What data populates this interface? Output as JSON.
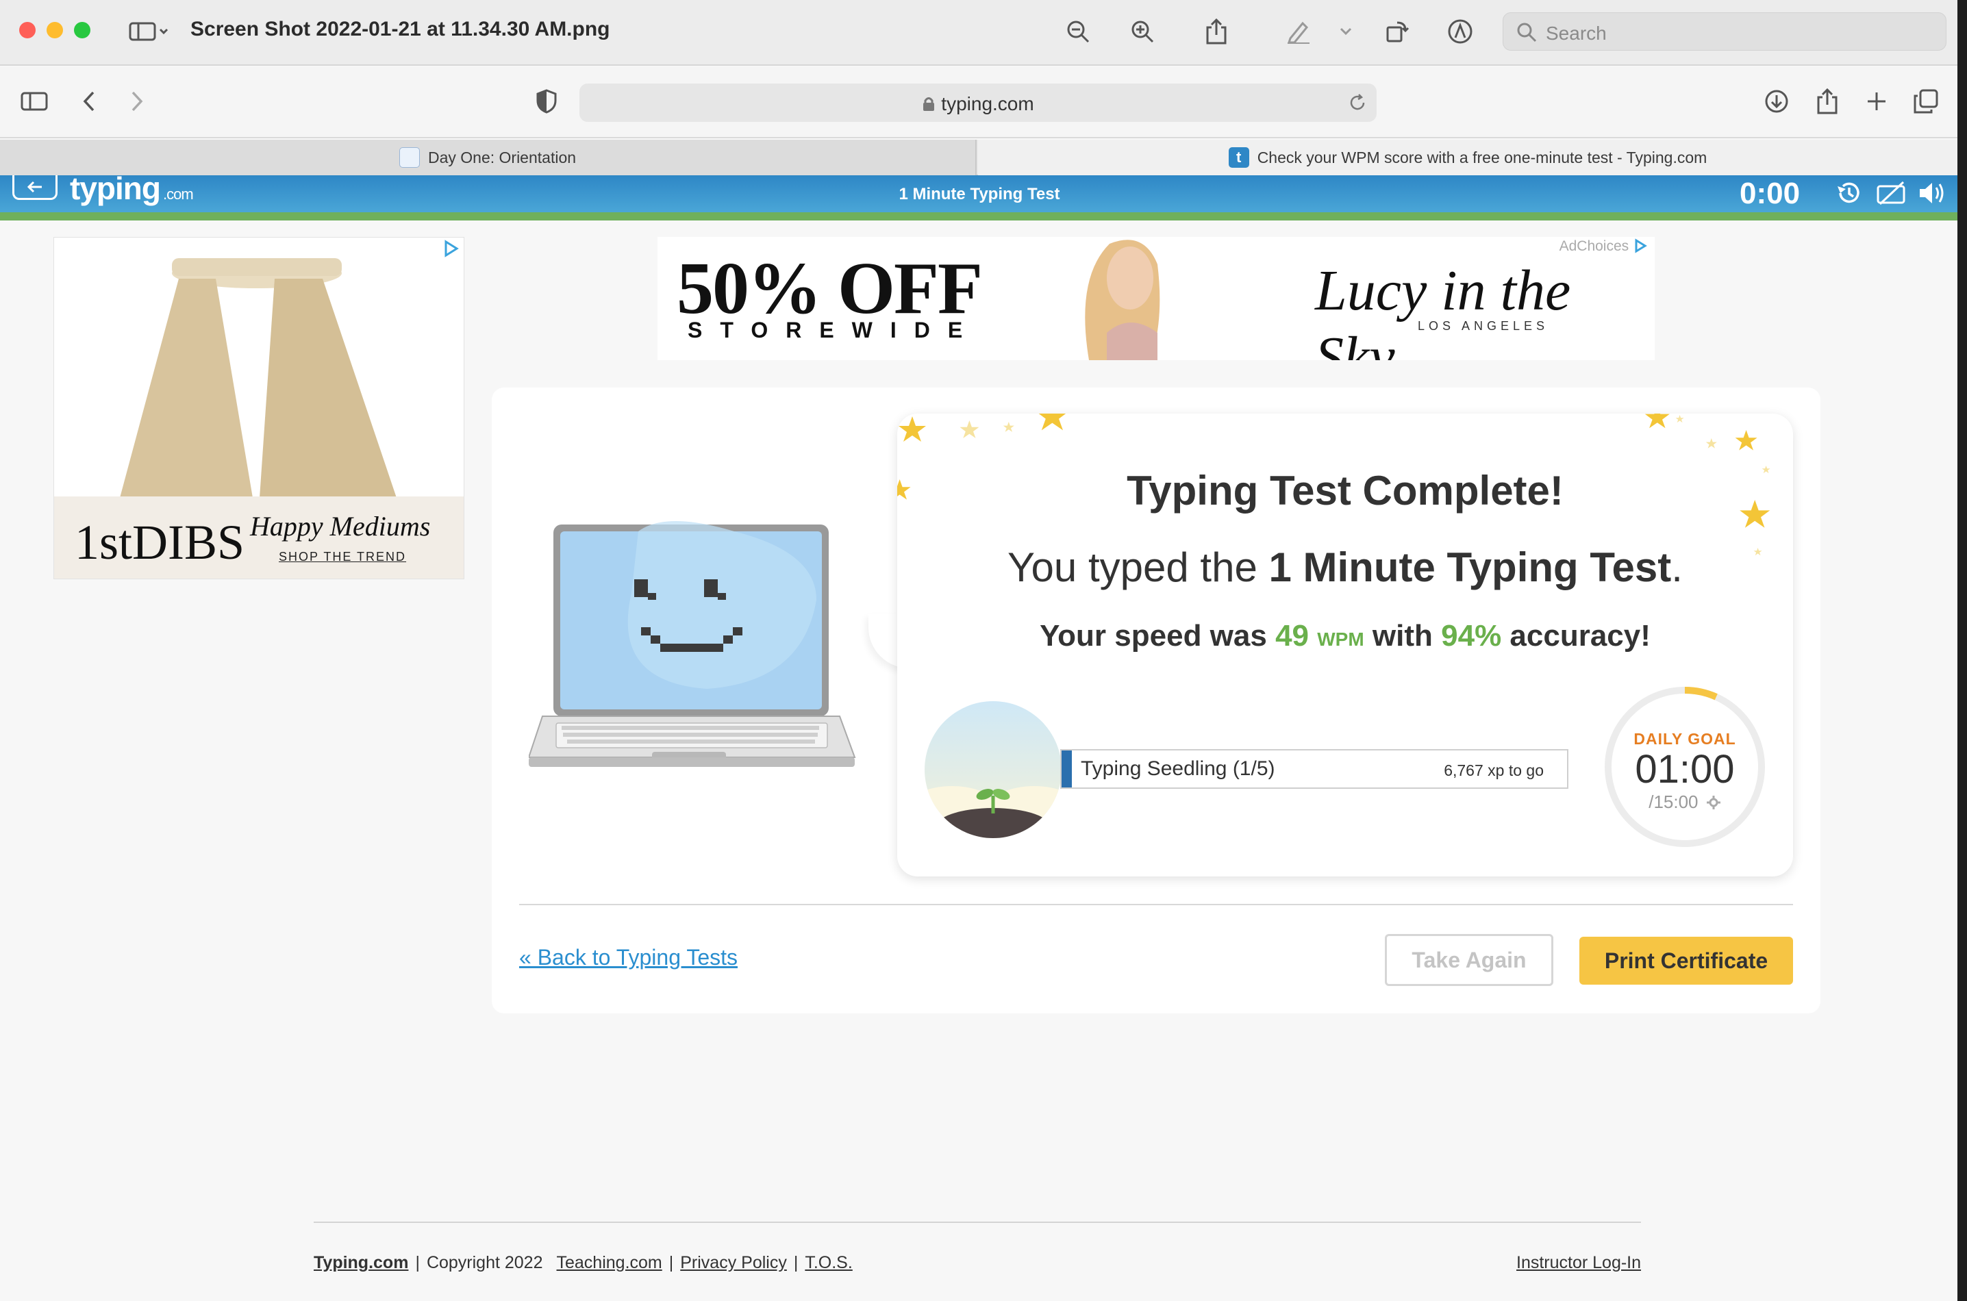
{
  "preview": {
    "document_title": "Screen Shot 2022-01-21 at 11.34.30 AM.png",
    "search_placeholder": "Search"
  },
  "browser": {
    "url": "typing.com",
    "tabs": [
      {
        "label": "Day One: Orientation",
        "active": false
      },
      {
        "label": "Check your WPM score with a free one-minute test - Typing.com",
        "active": true
      }
    ]
  },
  "site": {
    "logo_main": "typing",
    "logo_suffix": ".com",
    "header_title": "1 Minute Typing Test",
    "timer": "0:00",
    "colors": {
      "header": "#3b97cf",
      "accent_green": "#6ab04c",
      "print_button": "#f6c544"
    }
  },
  "ads": {
    "left": {
      "brand": "1stDIBS",
      "headline": "Happy Mediums",
      "cta": "SHOP THE TREND"
    },
    "top": {
      "headline": "50% OFF",
      "subline": "STOREWIDE",
      "brand": "Lucy in the Sky",
      "brand_sub": "LOS ANGELES",
      "adchoices": "AdChoices"
    }
  },
  "result": {
    "title": "Typing Test Complete!",
    "sub_prefix": "You typed the ",
    "sub_test": "1 Minute Typing Test",
    "sub_suffix": ".",
    "speed_prefix": "Your speed was ",
    "wpm": "49",
    "wpm_unit": "WPM",
    "speed_mid": " with ",
    "accuracy": "94%",
    "speed_suffix": " accuracy!"
  },
  "level": {
    "name": "Typing Seedling (1/5)",
    "xp_to_go": "6,767 xp to go",
    "progress": 0.02
  },
  "daily_goal": {
    "label": "DAILY GOAL",
    "time": "01:00",
    "total": "/15:00",
    "progress": 0.067
  },
  "actions": {
    "back_link": "« Back to Typing Tests",
    "take_again": "Take Again",
    "print_certificate": "Print Certificate"
  },
  "footer": {
    "links": [
      "Typing.com",
      "Teaching.com",
      "Privacy Policy",
      "T.O.S."
    ],
    "copyright": "Copyright 2022",
    "instructor_login": "Instructor Log-In"
  }
}
